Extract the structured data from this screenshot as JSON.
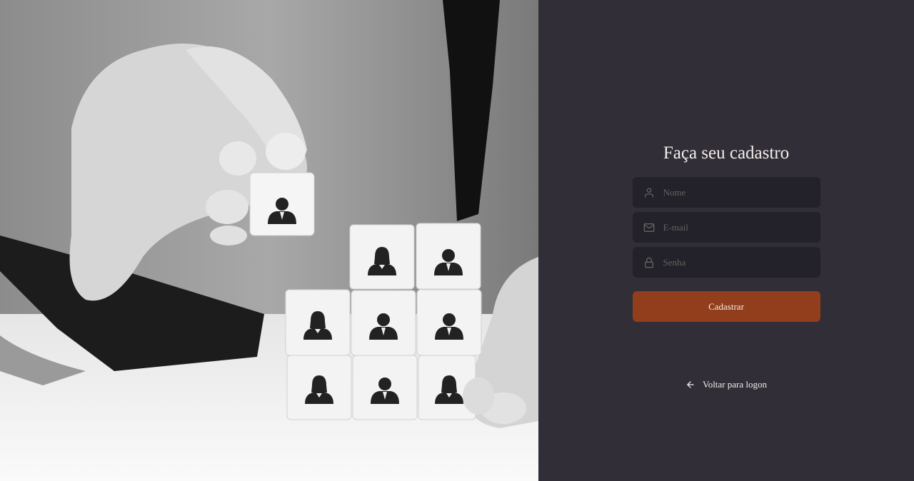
{
  "hero": {
    "image": "hand-stacking-people-blocks-photo"
  },
  "form": {
    "title": "Faça seu cadastro",
    "fields": [
      {
        "icon": "user-icon",
        "placeholder": "Nome",
        "type": "text"
      },
      {
        "icon": "mail-icon",
        "placeholder": "E-mail",
        "type": "email"
      },
      {
        "icon": "lock-icon",
        "placeholder": "Senha",
        "type": "password"
      }
    ],
    "submit_label": "Cadastrar"
  },
  "back_link": {
    "icon": "arrow-left-icon",
    "label": "Voltar para logon"
  },
  "colors": {
    "background": "#312e38",
    "input_background": "#232129",
    "placeholder": "#666360",
    "text": "#f4ede8",
    "button": "#923e1c"
  }
}
